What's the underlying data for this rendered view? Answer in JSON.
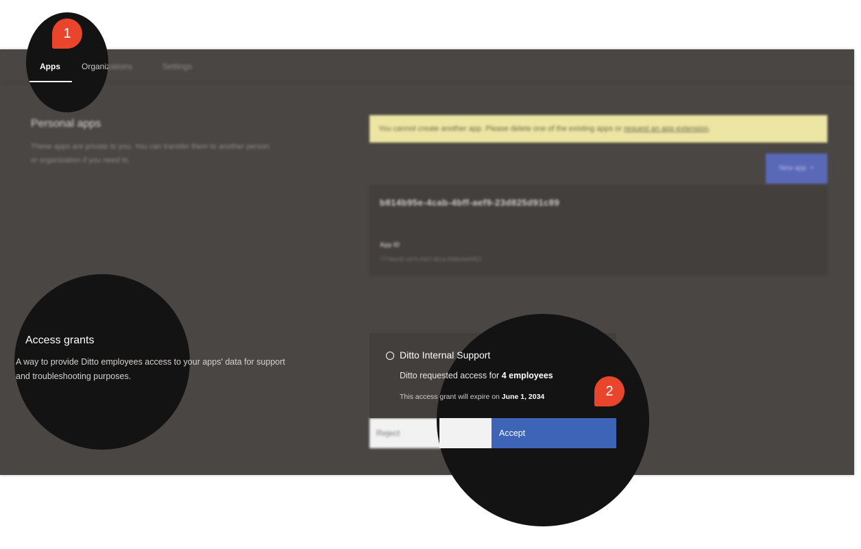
{
  "nav": {
    "tabs": [
      {
        "label": "Apps"
      },
      {
        "label": "Organizations"
      },
      {
        "label": "Settings"
      }
    ]
  },
  "personal_apps": {
    "title": "Personal apps",
    "description": "These apps are private to you. You can transfer them to another person or organization if you need to."
  },
  "warning": {
    "text": "You cannot create another app. Please delete one of the existing apps or ",
    "link": "request an app extension",
    "suffix": "."
  },
  "new_app_button": {
    "label": "New app",
    "icon": "plus-icon"
  },
  "app_card": {
    "name": "b814b95e-4cab-4bff-aef9-23d825d91c89",
    "id_label": "App ID",
    "id_value": "7774ee32-c474-4407-82ca-958fe0ef4453"
  },
  "access_grants": {
    "title": "Access grants",
    "description": "A way to provide Ditto employees access to your apps' data for support and troubleshooting purposes."
  },
  "grant": {
    "name": "Ditto Internal Support",
    "requester": "Ditto",
    "request_text": " requested access for ",
    "employees": "4 employees",
    "expiry_text": "This access grant will expire on ",
    "expiry_date": "June 1, 2034",
    "reject_label": "Reject",
    "accept_label": "Accept"
  },
  "markers": [
    {
      "label": "1"
    },
    {
      "label": "2"
    }
  ],
  "colors": {
    "panel": "#4a4644",
    "spotlight": "#131313",
    "accept": "#3e64b8",
    "warning": "#ece5a3",
    "marker": "#e8452c"
  }
}
